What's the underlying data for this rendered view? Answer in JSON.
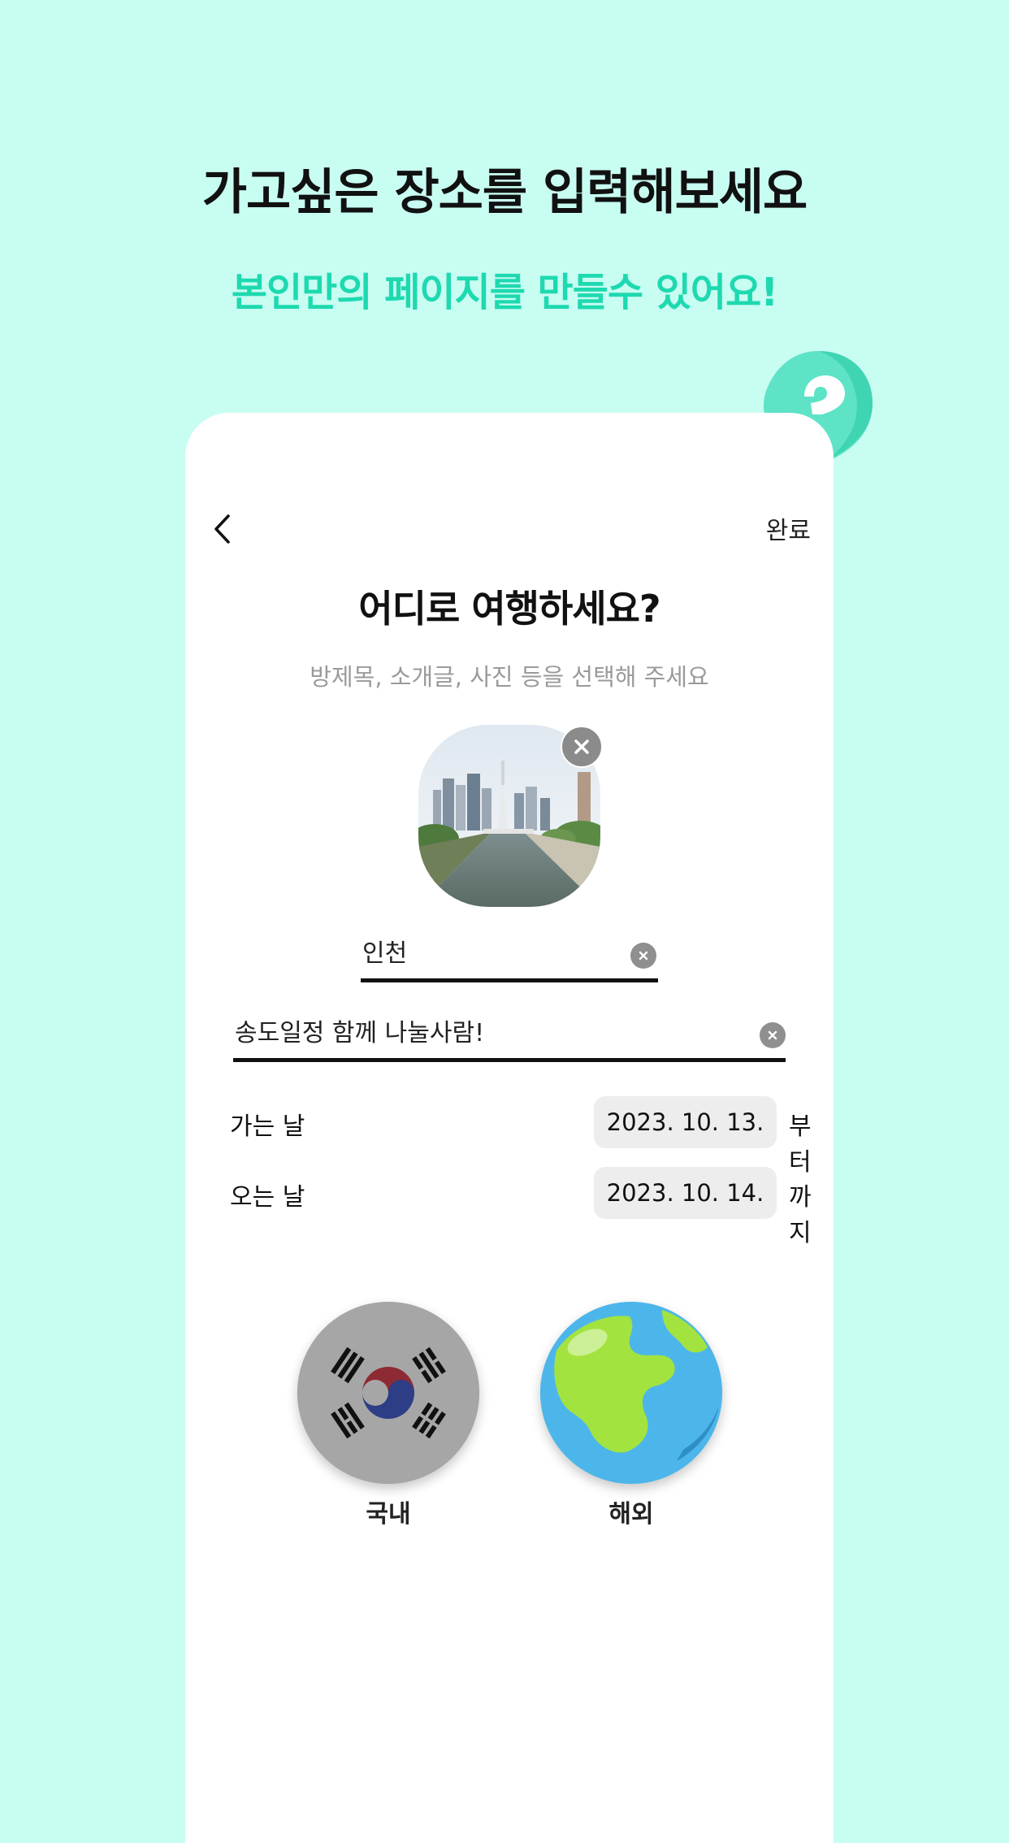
{
  "promo": {
    "headline": "가고싶은 장소를 입력해보세요",
    "subline": "본인만의 페이지를 만들수 있어요!"
  },
  "colors": {
    "background": "#c8fdf2",
    "accent": "#1ed9b0",
    "card": "#ffffff"
  },
  "header": {
    "back_icon": "chevron-left-icon",
    "done_label": "완료"
  },
  "form": {
    "title": "어디로 여행하세요?",
    "subtitle": "방제목, 소개글, 사진 등을 선택해 주세요",
    "place_value": "인천",
    "intro_value": "송도일정 함께 나눌사람!"
  },
  "dates": {
    "depart_label": "가는 날",
    "depart_value": "2023. 10. 13.",
    "depart_suffix": "부터",
    "return_label": "오는 날",
    "return_value": "2023. 10. 14.",
    "return_suffix": "까지"
  },
  "regions": {
    "domestic_label": "국내",
    "overseas_label": "해외"
  }
}
